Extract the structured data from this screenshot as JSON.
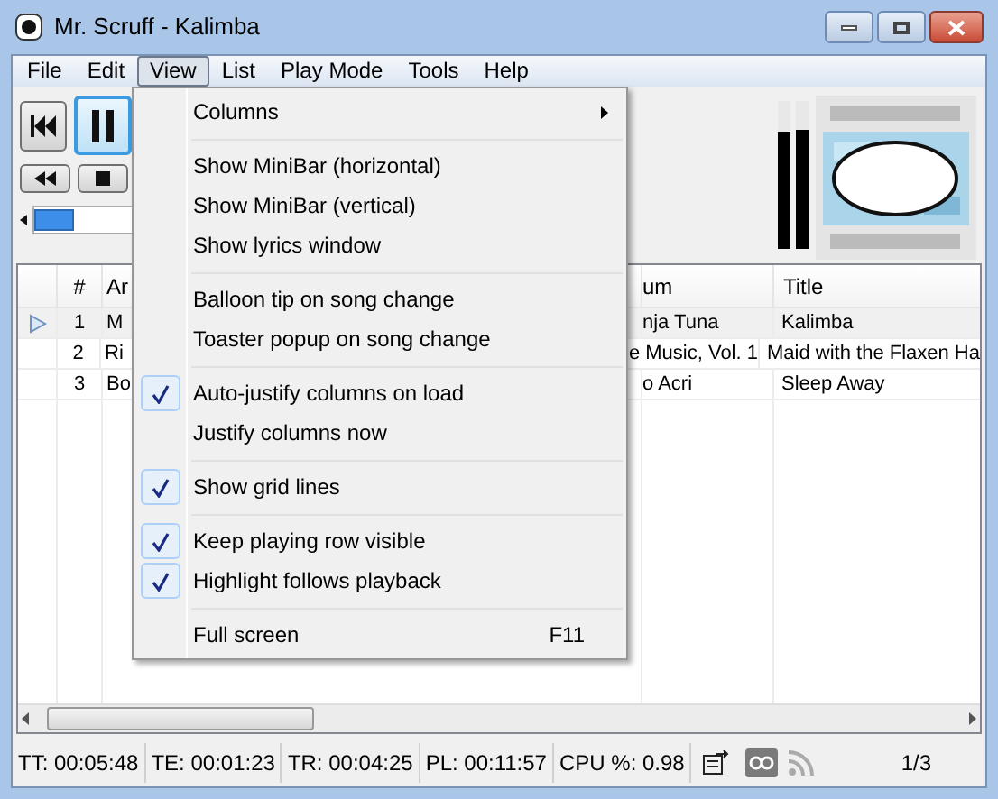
{
  "window": {
    "title": "Mr. Scruff - Kalimba"
  },
  "menu_bar": [
    {
      "label": "File",
      "selected": false
    },
    {
      "label": "Edit",
      "selected": false
    },
    {
      "label": "View",
      "selected": true
    },
    {
      "label": "List",
      "selected": false
    },
    {
      "label": "Play Mode",
      "selected": false
    },
    {
      "label": "Tools",
      "selected": false
    },
    {
      "label": "Help",
      "selected": false
    }
  ],
  "player": {
    "paused": true,
    "volume": {
      "level": 0.0
    }
  },
  "table": {
    "columns": [
      {
        "label": "#"
      },
      {
        "label": "Ar"
      },
      {
        "label": "um"
      },
      {
        "label": "Title"
      }
    ],
    "rows": [
      {
        "playing": true,
        "cells": [
          "1",
          "M",
          "nja Tuna",
          "Kalimba"
        ]
      },
      {
        "playing": false,
        "cells": [
          "2",
          "Ri",
          "e Music, Vol. 1",
          "Maid with the Flaxen Ha"
        ]
      },
      {
        "playing": false,
        "cells": [
          "3",
          "Bo",
          "o Acri",
          "Sleep Away"
        ]
      }
    ]
  },
  "view_menu": [
    {
      "kind": "item",
      "label": "Columns",
      "submenu": true,
      "checked": false
    },
    {
      "kind": "separator"
    },
    {
      "kind": "item",
      "label": "Show MiniBar (horizontal)",
      "checked": false
    },
    {
      "kind": "item",
      "label": "Show MiniBar (vertical)",
      "checked": false
    },
    {
      "kind": "item",
      "label": "Show lyrics window",
      "checked": false
    },
    {
      "kind": "separator"
    },
    {
      "kind": "item",
      "label": "Balloon tip on song change",
      "checked": false
    },
    {
      "kind": "item",
      "label": "Toaster popup on song change",
      "checked": false
    },
    {
      "kind": "separator"
    },
    {
      "kind": "item",
      "label": "Auto-justify columns on load",
      "checked": true
    },
    {
      "kind": "item",
      "label": "Justify columns now",
      "checked": false
    },
    {
      "kind": "separator"
    },
    {
      "kind": "item",
      "label": "Show grid lines",
      "checked": true
    },
    {
      "kind": "separator"
    },
    {
      "kind": "item",
      "label": "Keep playing row visible",
      "checked": true
    },
    {
      "kind": "item",
      "label": "Highlight follows playback",
      "checked": true
    },
    {
      "kind": "separator"
    },
    {
      "kind": "item",
      "label": "Full screen",
      "shortcut": "F11",
      "checked": false
    }
  ],
  "status_bar": {
    "fields": [
      "TT: 00:05:48",
      "TE: 00:01:23",
      "TR: 00:04:25",
      "PL: 00:11:57",
      "CPU %: 0.98"
    ],
    "page": "1/3"
  }
}
